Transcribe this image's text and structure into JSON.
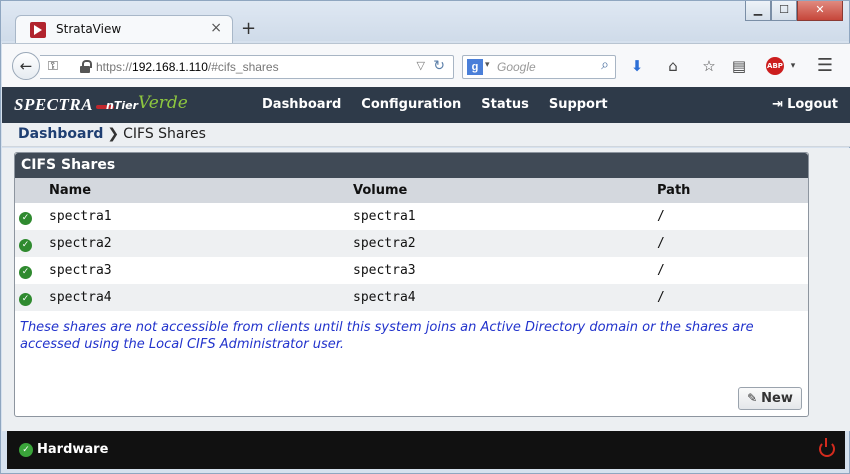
{
  "browser": {
    "tab_title": "StrataView",
    "tab_close": "×",
    "new_tab": "+",
    "window_controls": {
      "minimize": "▁",
      "maximize": "☐",
      "close": "✕"
    },
    "url_prefix": "https://",
    "url_host": "192.168.1.110",
    "url_path": "/#cifs_shares",
    "search_engine_icon": "google-icon",
    "search_placeholder": "Google",
    "icons": [
      "back-icon",
      "key-icon",
      "lock-icon",
      "dropdown-icon",
      "reload-icon",
      "search-icon",
      "download-icon",
      "home-icon",
      "bookmark-star-icon",
      "reader-list-icon",
      "adblock-icon",
      "menu-icon"
    ]
  },
  "app": {
    "logo": {
      "brand": "SPECTRA",
      "product": "nTier",
      "edition": "Verde"
    },
    "nav": [
      "Dashboard",
      "Configuration",
      "Status",
      "Support"
    ],
    "logout_label": "Logout",
    "colors": {
      "header_bg": "#2e3a49",
      "ok_green": "#2f8a2f",
      "note_blue": "#2233cc",
      "power_red": "#d42b1e"
    }
  },
  "breadcrumb": {
    "root": "Dashboard",
    "separator": "❯",
    "current": "CIFS Shares"
  },
  "panel": {
    "title": "CIFS Shares",
    "columns": [
      "Name",
      "Volume",
      "Path"
    ],
    "rows": [
      {
        "status": "ok",
        "name": "spectra1",
        "volume": "spectra1",
        "path": "/"
      },
      {
        "status": "ok",
        "name": "spectra2",
        "volume": "spectra2",
        "path": "/"
      },
      {
        "status": "ok",
        "name": "spectra3",
        "volume": "spectra3",
        "path": "/"
      },
      {
        "status": "ok",
        "name": "spectra4",
        "volume": "spectra4",
        "path": "/"
      }
    ],
    "note": "These shares are not accessible from clients until this system joins an Active Directory domain or the shares are accessed using the Local CIFS Administrator user.",
    "new_button": "New"
  },
  "footer": {
    "label": "Hardware",
    "status": "ok"
  }
}
